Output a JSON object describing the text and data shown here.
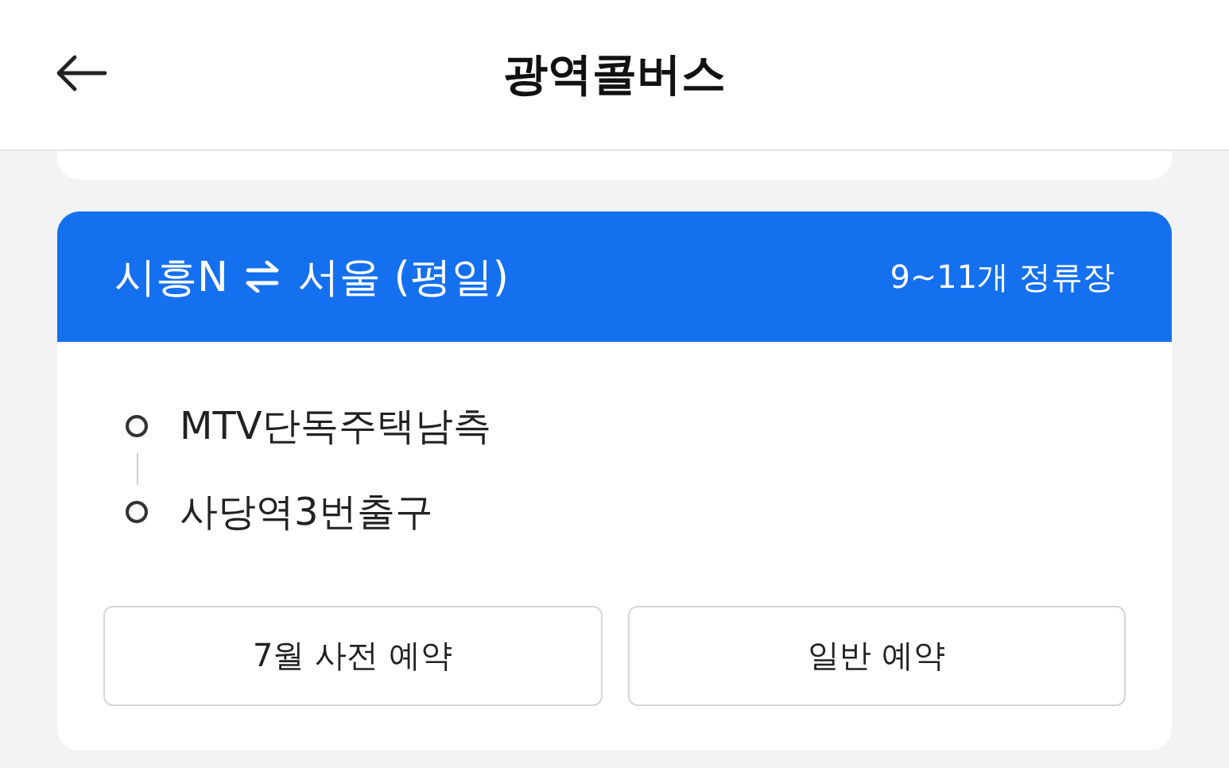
{
  "header": {
    "title": "광역콜버스"
  },
  "route_card": {
    "origin": "시흥N",
    "destination": "서울 (평일)",
    "stop_count": "9~11개 정류장",
    "stops": [
      "MTV단독주택남측",
      "사당역3번출구"
    ],
    "buttons": [
      "7월 사전 예약",
      "일반 예약"
    ]
  }
}
